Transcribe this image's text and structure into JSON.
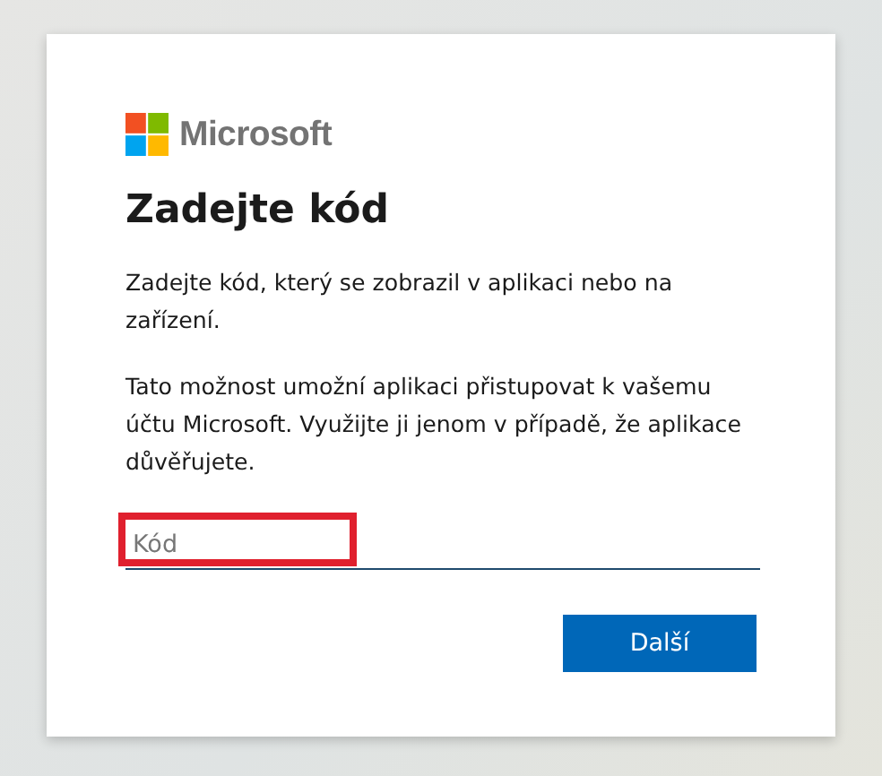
{
  "logo": {
    "text": "Microsoft"
  },
  "title": "Zadejte kód",
  "paragraphs": [
    "Zadejte kód, který se zobrazil v aplikaci nebo na zařízení.",
    "Tato možnost umožní aplikaci přistupovat k vašemu účtu Microsoft. Využijte ji jenom v případě, že aplikace důvěřujete."
  ],
  "code_field": {
    "placeholder": "Kód",
    "highlighted": true
  },
  "buttons": [
    {
      "label": "Další"
    }
  ]
}
